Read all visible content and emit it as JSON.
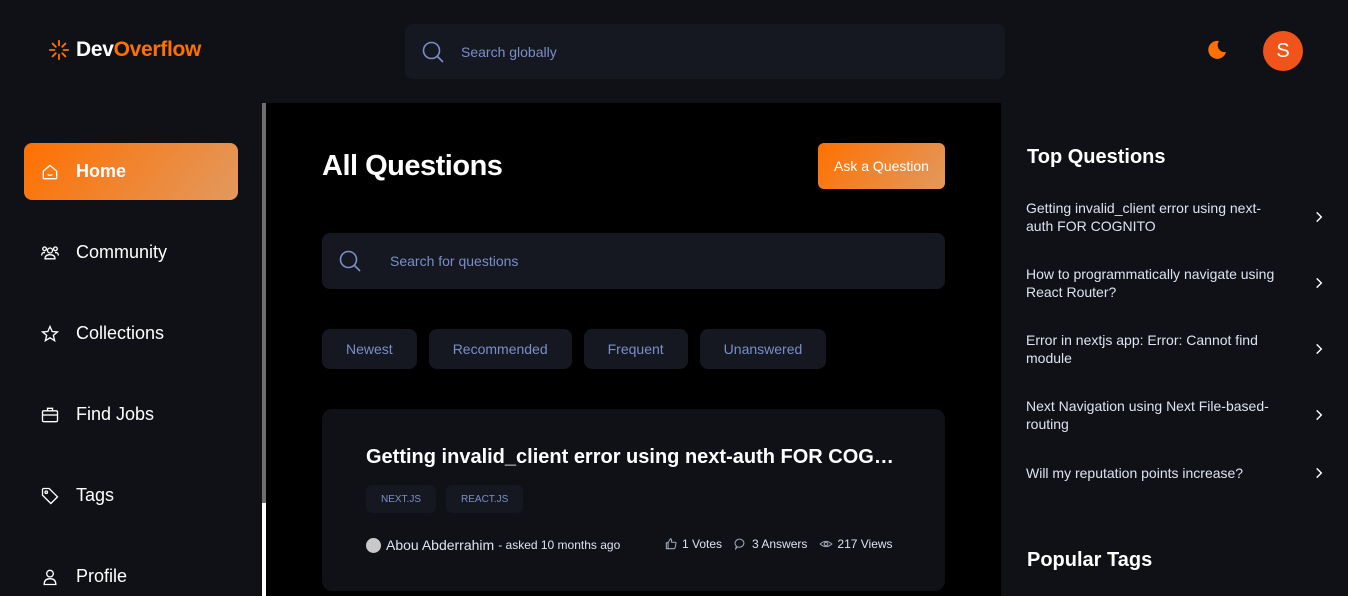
{
  "brand": {
    "name_part1": "Dev",
    "name_part2": "Overflow",
    "accent": "#ff7000"
  },
  "header": {
    "search_placeholder": "Search globally",
    "theme_icon": "moon-icon",
    "avatar_initial": "S"
  },
  "sidebar": {
    "items": [
      {
        "label": "Home",
        "icon": "home-icon",
        "active": true
      },
      {
        "label": "Community",
        "icon": "users-icon",
        "active": false
      },
      {
        "label": "Collections",
        "icon": "star-icon",
        "active": false
      },
      {
        "label": "Find Jobs",
        "icon": "briefcase-icon",
        "active": false
      },
      {
        "label": "Tags",
        "icon": "tag-icon",
        "active": false
      },
      {
        "label": "Profile",
        "icon": "user-icon",
        "active": false
      }
    ]
  },
  "main": {
    "title": "All Questions",
    "ask_button": "Ask a Question",
    "search_placeholder": "Search for questions",
    "filters": [
      "Newest",
      "Recommended",
      "Frequent",
      "Unanswered"
    ],
    "questions": [
      {
        "title": "Getting invalid_client error using next-auth FOR COGNITO",
        "tags": [
          "NEXT.JS",
          "REACT.JS"
        ],
        "author": "Abou Abderrahim",
        "asked": "- asked 10 months ago",
        "votes": "1 Votes",
        "answers": "3 Answers",
        "views": "217 Views"
      }
    ]
  },
  "right_sidebar": {
    "top_questions_heading": "Top Questions",
    "top_questions": [
      "Getting invalid_client error using next-auth FOR COGNITO",
      "How to programmatically navigate using React Router?",
      "Error in nextjs app: Error: Cannot find module",
      "Next Navigation using Next File-based-routing",
      "Will my reputation points increase?"
    ],
    "popular_tags_heading": "Popular Tags"
  }
}
